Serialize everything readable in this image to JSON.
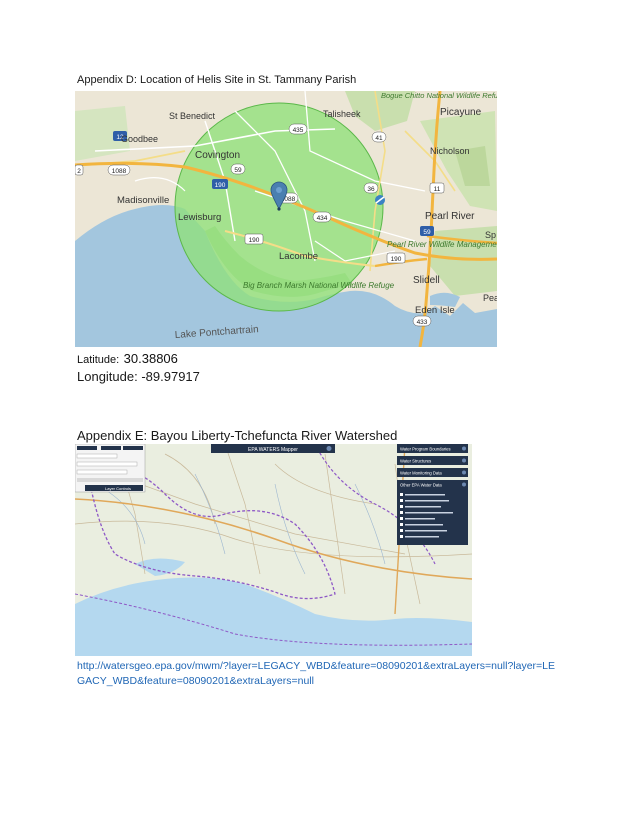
{
  "appendix_d": {
    "title": "Appendix D: Location of Helis Site in St. Tammany Parish",
    "latitude_label": "Latitude:",
    "latitude_value": "30.38806",
    "longitude_line": "Longitude: -89.97917",
    "map": {
      "place_labels": [
        "Bogue Chitto National Wildlife Refuge",
        "St Benedict",
        "Talisheek",
        "Picayune",
        "Goodbee",
        "Covington",
        "Nicholson",
        "Madisonville",
        "Lewisburg",
        "Pearl River",
        "Lacombe",
        "Pearl River Wildlife Management Area",
        "Slidell",
        "Big Branch Marsh National Wildlife Refuge",
        "Eden Isle",
        "Lake Pontchartrain",
        "Sp",
        "Pea"
      ],
      "route_shields": [
        "12",
        "435",
        "41",
        "1088",
        "59",
        "190",
        "36",
        "11",
        "1088",
        "434",
        "190",
        "59",
        "190",
        "433",
        "2"
      ],
      "colors": {
        "land": "#ece6d6",
        "water": "#a3c6de",
        "forest": "#c9dfae",
        "radius_fill": "#8fe07a",
        "radius_stroke": "#5bb84a",
        "interstate": "#f2b53f",
        "marker": "#4a7fb0"
      }
    }
  },
  "appendix_e": {
    "title": "Appendix E: Bayou Liberty-Tchefuncta River Watershed",
    "map": {
      "top_banner": "EPA WATERS Mapper",
      "right_panel": [
        "Water Program Boundaries",
        "Water Structures",
        "Water Monitoring Data",
        "Other EPA Water Data"
      ],
      "left_panel_button": "Layer Controls",
      "colors": {
        "land": "#eaeee0",
        "water": "#b4d8ef",
        "panel": "#23334b",
        "boundary": "#8e58c6"
      }
    },
    "url": "http://watersgeo.epa.gov/mwm/?layer=LEGACY_WBD&feature=08090201&extraLayers=null?layer=LEGACY_WBD&feature=08090201&extraLayers=null"
  }
}
